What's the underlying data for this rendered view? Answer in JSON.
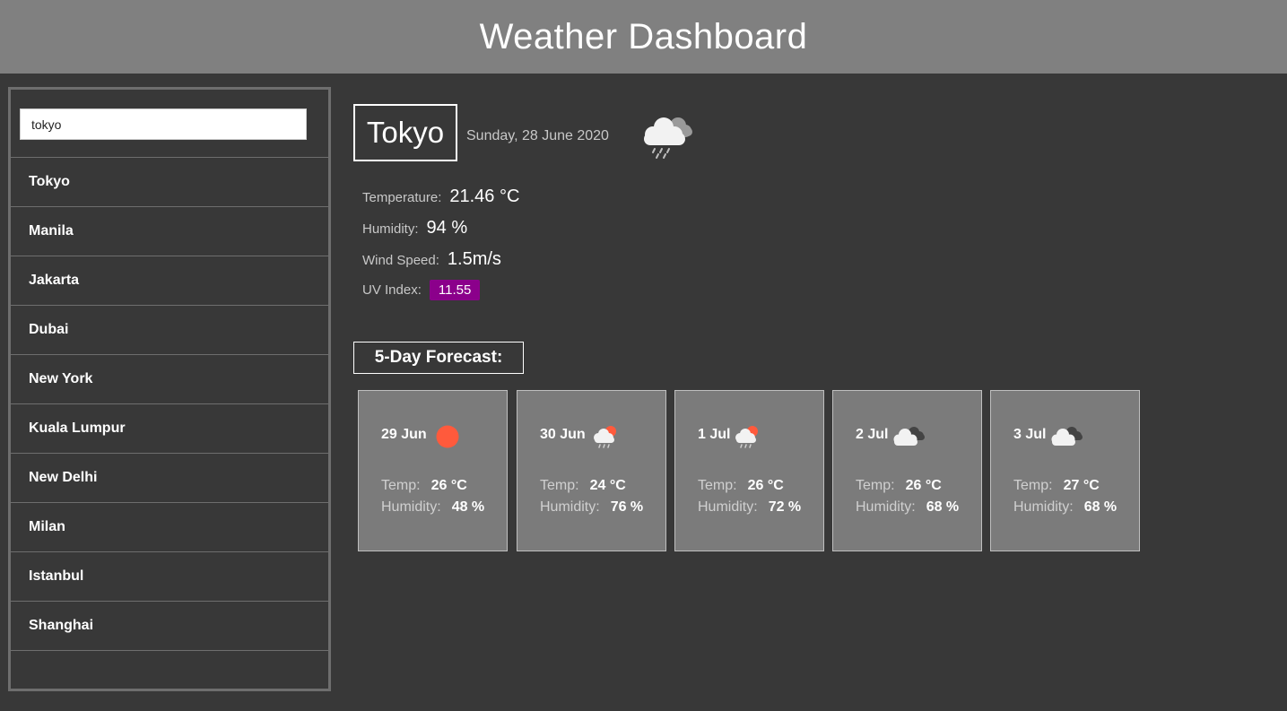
{
  "header": {
    "title": "Weather Dashboard"
  },
  "search": {
    "value": "tokyo"
  },
  "sidebar": {
    "cities": [
      "Tokyo",
      "Manila",
      "Jakarta",
      "Dubai",
      "New York",
      "Kuala Lumpur",
      "New Delhi",
      "Milan",
      "Istanbul",
      "Shanghai"
    ]
  },
  "current": {
    "city": "Tokyo",
    "date": "Sunday, 28 June 2020",
    "icon": "rain-cloud-icon",
    "temperature_label": "Temperature:",
    "temperature": "21.46 °C",
    "humidity_label": "Humidity:",
    "humidity": "94 %",
    "wind_label": "Wind Speed:",
    "wind": "1.5m/s",
    "uv_label": "UV Index:",
    "uv": "11.55",
    "uv_color": "#8b008b"
  },
  "forecast": {
    "title": "5-Day Forecast:",
    "temp_label": "Temp:",
    "humidity_label": "Humidity:",
    "days": [
      {
        "date": "29 Jun",
        "icon": "sun-icon",
        "temp": "26 °C",
        "humidity": "48 %"
      },
      {
        "date": "30 Jun",
        "icon": "sun-rain-cloud-icon",
        "temp": "24 °C",
        "humidity": "76 %"
      },
      {
        "date": "1 Jul",
        "icon": "sun-rain-cloud-icon",
        "temp": "26 °C",
        "humidity": "72 %"
      },
      {
        "date": "2 Jul",
        "icon": "cloudy-icon",
        "temp": "26 °C",
        "humidity": "68 %"
      },
      {
        "date": "3 Jul",
        "icon": "cloudy-icon",
        "temp": "27 °C",
        "humidity": "68 %"
      }
    ]
  },
  "colors": {
    "header_bg": "#808080",
    "page_bg": "#383838",
    "card_bg": "#7b7b7b",
    "sun": "#ff5a3c"
  }
}
